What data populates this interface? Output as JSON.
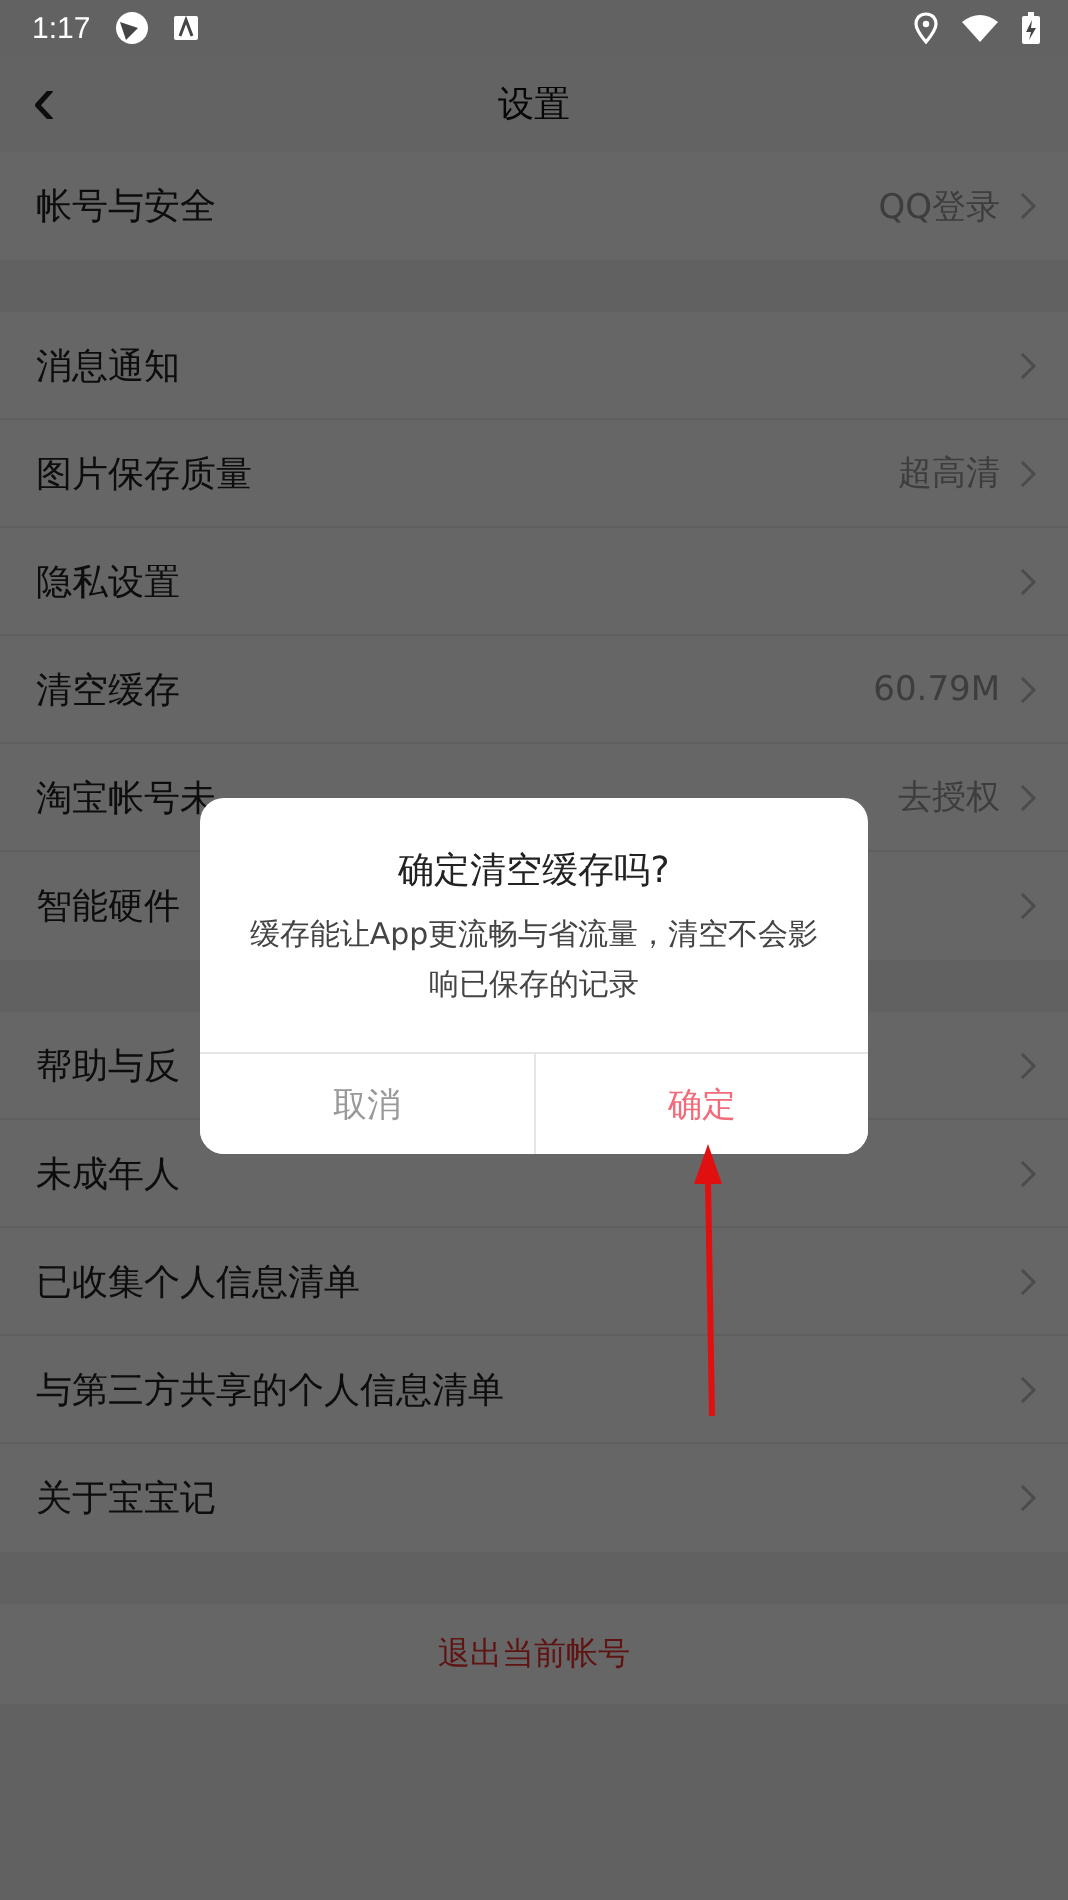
{
  "status_bar": {
    "time": "1:17"
  },
  "header": {
    "back": "‹",
    "title": "设置"
  },
  "groups": [
    {
      "rows": [
        {
          "label": "帐号与安全",
          "value": "QQ登录"
        }
      ]
    },
    {
      "rows": [
        {
          "label": "消息通知"
        },
        {
          "label": "图片保存质量",
          "value": "超高清"
        },
        {
          "label": "隐私设置"
        },
        {
          "label": "清空缓存",
          "value": "60.79M"
        },
        {
          "label": "淘宝帐号未",
          "value": "去授权"
        },
        {
          "label": "智能硬件"
        }
      ]
    },
    {
      "rows": [
        {
          "label": "帮助与反"
        },
        {
          "label": "未成年人"
        },
        {
          "label": "已收集个人信息清单"
        },
        {
          "label": "与第三方共享的个人信息清单"
        },
        {
          "label": "关于宝宝记"
        }
      ]
    }
  ],
  "logout": "退出当前帐号",
  "dialog": {
    "title": "确定清空缓存吗?",
    "message": "缓存能让App更流畅与省流量，清空不会影响已保存的记录",
    "buttons": [
      {
        "label": "取消",
        "kind": "cancel"
      },
      {
        "label": "确定",
        "kind": "confirm"
      }
    ]
  }
}
